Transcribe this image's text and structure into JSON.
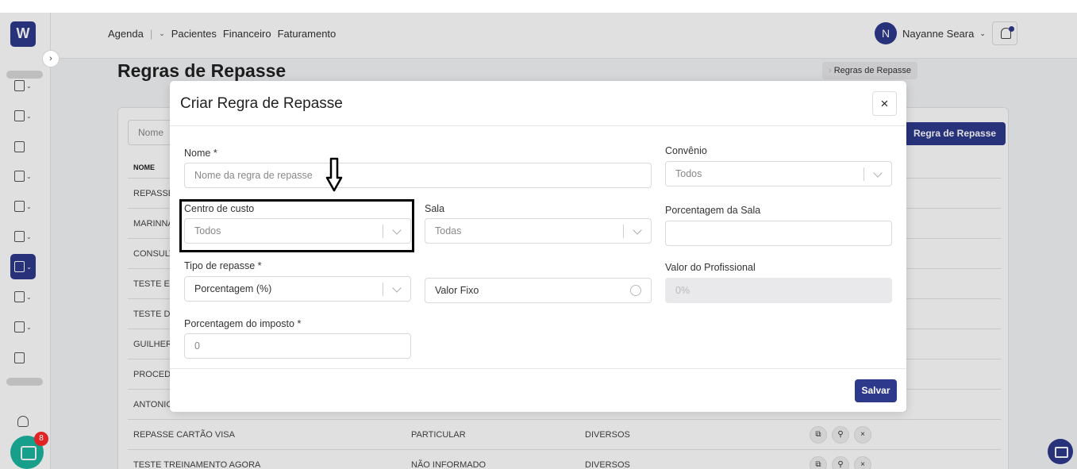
{
  "topnav": {
    "links": [
      "Agenda",
      "Pacientes",
      "Financeiro",
      "Faturamento"
    ],
    "user_initial": "N",
    "user_name": "Nayanne Seara"
  },
  "sidebar": {
    "logo": "W",
    "chat_badge": "8"
  },
  "page": {
    "title": "Regras de Repasse",
    "breadcrumb_current": "Regras de Repasse",
    "filter_placeholder": "Nome",
    "new_button": "Regra de Repasse"
  },
  "table": {
    "header_name": "NOME",
    "rows": [
      {
        "name": "REPASSE",
        "type": "",
        "category": ""
      },
      {
        "name": "MARINNA",
        "type": "",
        "category": ""
      },
      {
        "name": "CONSULT",
        "type": "",
        "category": ""
      },
      {
        "name": "TESTE ER",
        "type": "",
        "category": ""
      },
      {
        "name": "TESTE DE",
        "type": "",
        "category": ""
      },
      {
        "name": "GUILHERM",
        "type": "",
        "category": ""
      },
      {
        "name": "PROCEDI",
        "type": "",
        "category": ""
      },
      {
        "name": "ANTONIO",
        "type": "",
        "category": ""
      },
      {
        "name": "REPASSE CARTÃO VISA",
        "type": "PARTICULAR",
        "category": "DIVERSOS"
      },
      {
        "name": "TESTE TREINAMENTO AGORA",
        "type": "NÃO INFORMADO",
        "category": "DIVERSOS"
      }
    ]
  },
  "modal": {
    "title": "Criar Regra de Repasse",
    "close_icon": "×",
    "nome_label": "Nome *",
    "nome_placeholder": "Nome da regra de repasse",
    "convenio_label": "Convênio",
    "convenio_value": "Todos",
    "centro_label": "Centro de custo",
    "centro_value": "Todos",
    "sala_label": "Sala",
    "sala_value": "Todas",
    "porc_sala_label": "Porcentagem da Sala",
    "porc_sala_value": "",
    "tipo_label": "Tipo de repasse *",
    "tipo_value": "Porcentagem (%)",
    "valor_fixo_label": "Valor Fixo",
    "valor_prof_label": "Valor do Profissional",
    "valor_prof_value": "0%",
    "imposto_label": "Porcentagem do imposto *",
    "imposto_value": "0",
    "save_label": "Salvar"
  },
  "colors": {
    "brand": "#2d3a8c",
    "chat": "#1cb5a0",
    "badge": "#e02424"
  }
}
